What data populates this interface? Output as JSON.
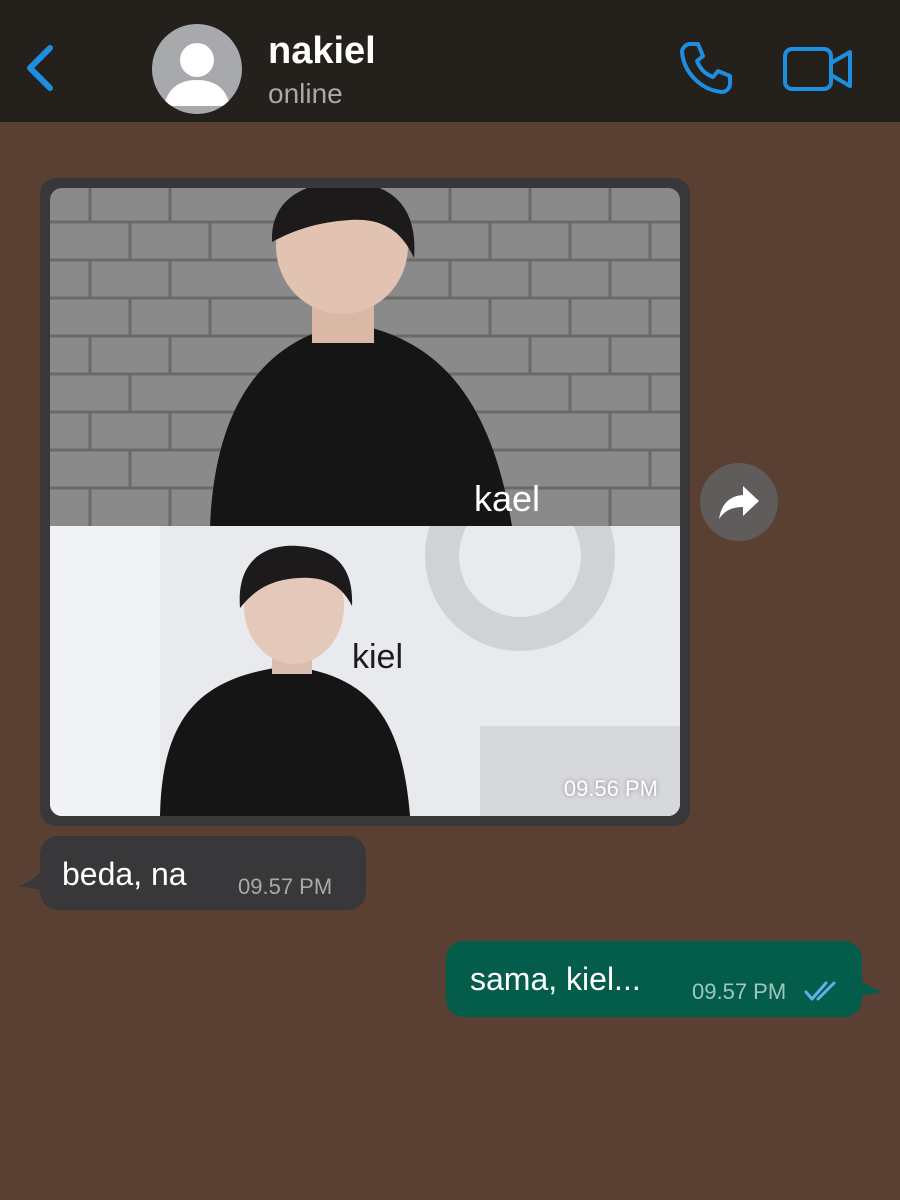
{
  "header": {
    "contact_name": "nakiel",
    "status": "online",
    "icons": {
      "back": "chevron-left-icon",
      "avatar": "default-avatar-icon",
      "call": "phone-icon",
      "video": "video-camera-icon"
    },
    "accent_color": "#1e8fe0"
  },
  "messages": [
    {
      "type": "image",
      "direction": "incoming",
      "captions": [
        "kael",
        "kiel"
      ],
      "time": "09.56 PM",
      "forward_icon": "forward-arrow-icon"
    },
    {
      "type": "text",
      "direction": "incoming",
      "text": "beda, na",
      "time": "09.57 PM"
    },
    {
      "type": "text",
      "direction": "outgoing",
      "text": "sama, kiel...",
      "time": "09.57 PM",
      "status_icon": "double-check-read-icon"
    }
  ],
  "colors": {
    "chat_background": "#5a4033",
    "header_background": "#24201c",
    "incoming_bubble": "#38373a",
    "outgoing_bubble": "#045c4a",
    "read_ticks": "#5fb0e8"
  }
}
